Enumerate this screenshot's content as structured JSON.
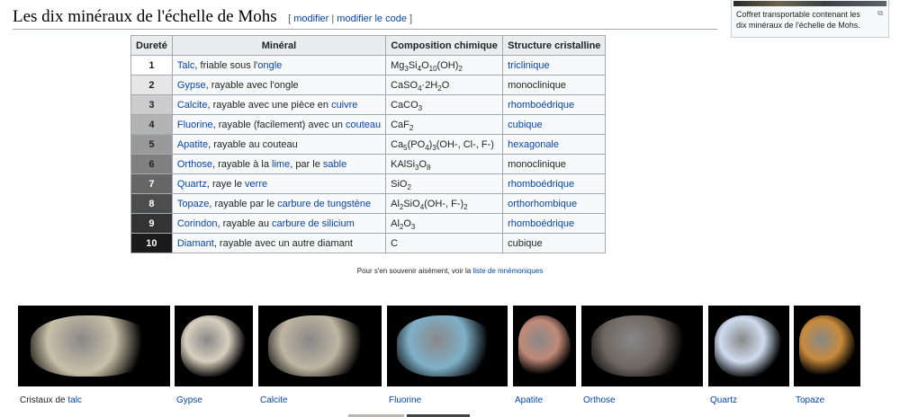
{
  "heading": {
    "title": "Les dix minéraux de l'échelle de Mohs",
    "edit_open": "[",
    "edit": "modifier",
    "sep": "|",
    "edit_code": "modifier le code",
    "edit_close": "]"
  },
  "thumb": {
    "caption": "Coffret transportable contenant les dix minéraux de l'échelle de Mohs.",
    "icon": "magnify-icon"
  },
  "table": {
    "headers": [
      "Dureté",
      "Minéral",
      "Composition chimique",
      "Structure cristalline"
    ],
    "rows": [
      {
        "hardness": "1",
        "shade": "#ffffff",
        "fg": "#222222",
        "mineral": [
          {
            "t": "Talc",
            "l": true
          },
          {
            "t": ", friable sous l'"
          },
          {
            "t": "ongle",
            "l": true
          }
        ],
        "formula": [
          [
            "Mg",
            "3"
          ],
          [
            "Si",
            "4"
          ],
          [
            "O",
            "10"
          ],
          [
            "(OH)",
            "2"
          ]
        ],
        "structure": "triclinique",
        "structure_link": true
      },
      {
        "hardness": "2",
        "shade": "#e6e6e6",
        "fg": "#222222",
        "mineral": [
          {
            "t": "Gypse",
            "l": true
          },
          {
            "t": ", rayable avec l'ongle"
          }
        ],
        "formula": [
          [
            "CaSO",
            "4"
          ],
          [
            "·2H",
            "2"
          ],
          [
            "O",
            ""
          ]
        ],
        "structure": "monoclinique",
        "structure_link": false
      },
      {
        "hardness": "3",
        "shade": "#cccccc",
        "fg": "#222222",
        "mineral": [
          {
            "t": "Calcite",
            "l": true
          },
          {
            "t": ", rayable avec une pièce en "
          },
          {
            "t": "cuivre",
            "l": true
          }
        ],
        "formula": [
          [
            "CaCO",
            "3"
          ]
        ],
        "structure": "rhomboédrique",
        "structure_link": true
      },
      {
        "hardness": "4",
        "shade": "#b3b3b3",
        "fg": "#222222",
        "mineral": [
          {
            "t": "Fluorine",
            "l": true
          },
          {
            "t": ", rayable (facilement) avec un "
          },
          {
            "t": "couteau",
            "l": true
          }
        ],
        "formula": [
          [
            "CaF",
            "2"
          ]
        ],
        "structure": "cubique",
        "structure_link": true
      },
      {
        "hardness": "5",
        "shade": "#999999",
        "fg": "#222222",
        "mineral": [
          {
            "t": "Apatite",
            "l": true
          },
          {
            "t": ", rayable au couteau"
          }
        ],
        "formula": [
          [
            "Ca",
            "5"
          ],
          [
            "(PO",
            "4"
          ],
          [
            ")",
            "3"
          ],
          [
            "(OH-, Cl-, F-)",
            ""
          ]
        ],
        "structure": "hexagonale",
        "structure_link": true
      },
      {
        "hardness": "6",
        "shade": "#808080",
        "fg": "#222222",
        "mineral": [
          {
            "t": "Orthose",
            "l": true
          },
          {
            "t": ", rayable à la "
          },
          {
            "t": "lime",
            "l": true
          },
          {
            "t": ", par le "
          },
          {
            "t": "sable",
            "l": true
          }
        ],
        "formula": [
          [
            "KAlSi",
            "3"
          ],
          [
            "O",
            "8"
          ]
        ],
        "structure": "monoclinique",
        "structure_link": false
      },
      {
        "hardness": "7",
        "shade": "#666666",
        "fg": "#ffffff",
        "mineral": [
          {
            "t": "Quartz",
            "l": true
          },
          {
            "t": ", raye le "
          },
          {
            "t": "verre",
            "l": true
          }
        ],
        "formula": [
          [
            "SiO",
            "2"
          ]
        ],
        "structure": "rhomboédrique",
        "structure_link": true
      },
      {
        "hardness": "8",
        "shade": "#4d4d4d",
        "fg": "#ffffff",
        "mineral": [
          {
            "t": "Topaze",
            "l": true
          },
          {
            "t": ", rayable par le "
          },
          {
            "t": "carbure de tungstène",
            "l": true
          }
        ],
        "formula": [
          [
            "Al",
            "2"
          ],
          [
            "SiO",
            "4"
          ],
          [
            "(OH-, F-)",
            "2"
          ]
        ],
        "structure": "orthorhombique",
        "structure_link": true
      },
      {
        "hardness": "9",
        "shade": "#333333",
        "fg": "#ffffff",
        "mineral": [
          {
            "t": "Corindon",
            "l": true
          },
          {
            "t": ", rayable au "
          },
          {
            "t": "carbure de silicium",
            "l": true
          }
        ],
        "formula": [
          [
            "Al",
            "2"
          ],
          [
            "O",
            "3"
          ]
        ],
        "structure": "rhomboédrique",
        "structure_link": true
      },
      {
        "hardness": "10",
        "shade": "#1a1a1a",
        "fg": "#ffffff",
        "mineral": [
          {
            "t": "Diamant",
            "l": true
          },
          {
            "t": ", rayable avec un autre diamant"
          }
        ],
        "formula": [
          [
            "C",
            ""
          ]
        ],
        "structure": "cubique",
        "structure_link": false
      }
    ]
  },
  "mnemonic": {
    "text": "Pour s'en souvenir aisément, voir la ",
    "link": "liste de mnémoniques"
  },
  "gallery": [
    {
      "prefix": "Cristaux de ",
      "label": "talc",
      "color": "#c9c0a8"
    },
    {
      "prefix": "",
      "label": "Gypse",
      "color": "#d8cfc0"
    },
    {
      "prefix": "",
      "label": "Calcite",
      "color": "#bfb5a2"
    },
    {
      "prefix": "",
      "label": "Fluorine",
      "color": "#7fb0c8"
    },
    {
      "prefix": "",
      "label": "Apatite",
      "color": "#c08a78"
    },
    {
      "prefix": "",
      "label": "Orthose",
      "color": "#6e6660"
    },
    {
      "prefix": "",
      "label": "Quartz",
      "color": "#cfdcef"
    },
    {
      "prefix": "",
      "label": "Topaze",
      "color": "#c88a3c"
    }
  ]
}
